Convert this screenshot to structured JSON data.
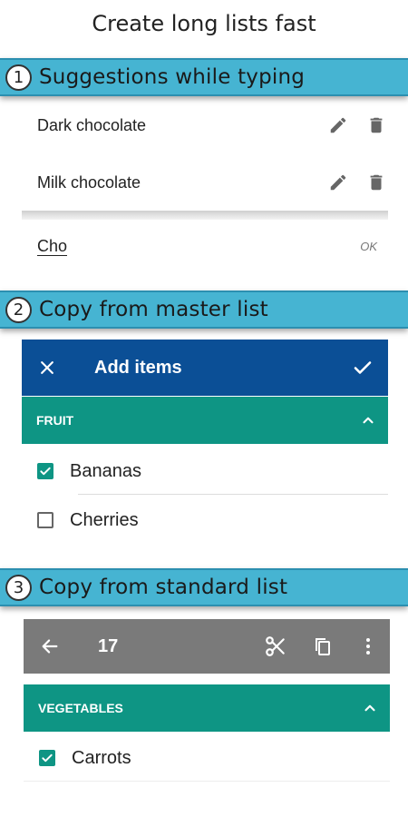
{
  "header": {
    "title": "Create long lists fast"
  },
  "sections": [
    {
      "number": "1",
      "title": "Suggestions while typing"
    },
    {
      "number": "2",
      "title": "Copy from master list"
    },
    {
      "number": "3",
      "title": "Copy from standard list"
    }
  ],
  "suggestions": {
    "items": [
      {
        "label": "Dark chocolate",
        "edit_icon": "pencil-icon",
        "delete_icon": "trash-icon"
      },
      {
        "label": "Milk chocolate",
        "edit_icon": "pencil-icon",
        "delete_icon": "trash-icon"
      }
    ],
    "input": {
      "value": "Cho",
      "ok_label": "OK"
    }
  },
  "master": {
    "toolbar": {
      "title": "Add items",
      "close_icon": "close-icon",
      "confirm_icon": "check-icon",
      "color": "#0b4f96"
    },
    "category": {
      "label": "FRUIT",
      "icon": "chevron-up-icon",
      "color": "#0e9584"
    },
    "items": [
      {
        "label": "Bananas",
        "checked": true
      },
      {
        "label": "Cherries",
        "checked": false
      }
    ]
  },
  "standard": {
    "toolbar": {
      "count": "17",
      "back_icon": "arrow-back-icon",
      "cut_icon": "scissors-icon",
      "copy_icon": "copy-icon",
      "menu_icon": "more-vert-icon",
      "color": "#7a7a7a"
    },
    "category": {
      "label": "VEGETABLES",
      "icon": "chevron-up-icon",
      "color": "#0e9584"
    },
    "items": [
      {
        "label": "Carrots",
        "checked": true
      }
    ]
  },
  "colors": {
    "banner": "#46b4d2",
    "accent": "#0e9584"
  }
}
